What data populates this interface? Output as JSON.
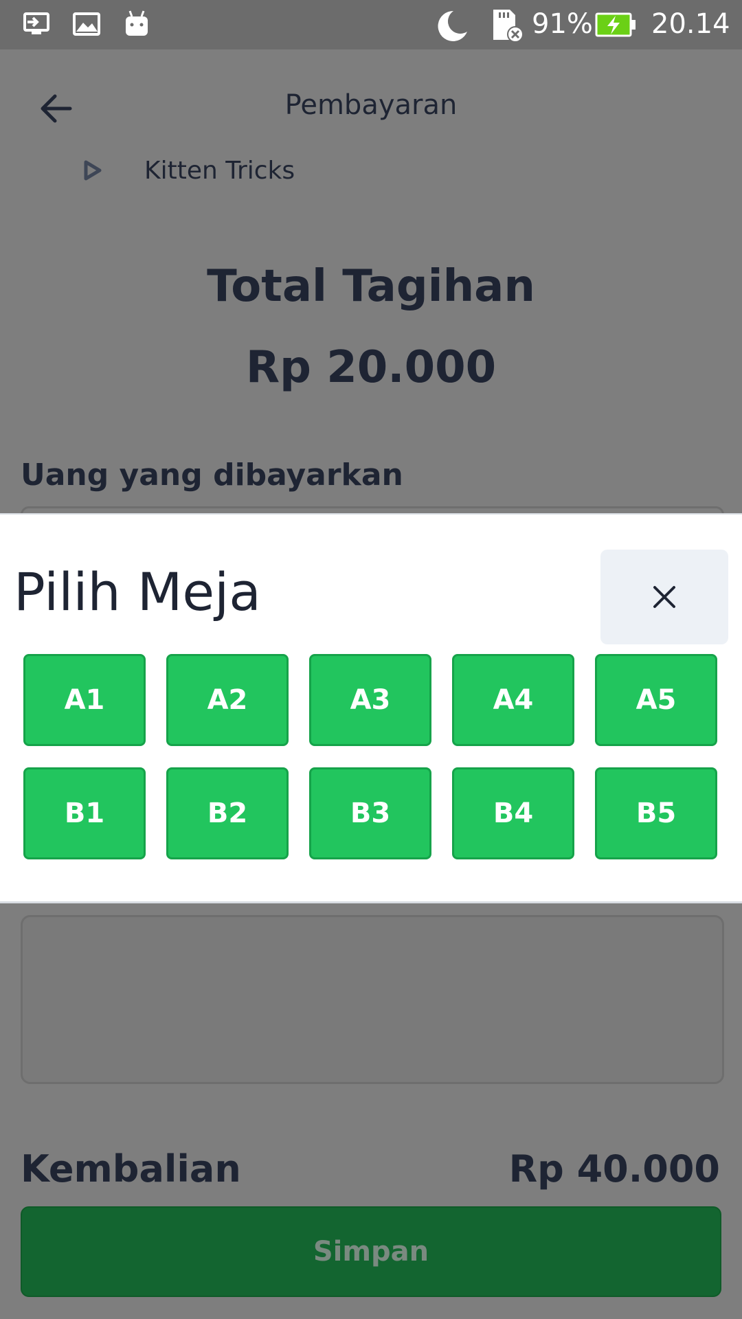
{
  "status_bar": {
    "battery_percent": "91%",
    "time": "20.14",
    "icons": [
      "screen-share-icon",
      "image-icon",
      "android-icon",
      "moon-icon",
      "sdcard-error-icon",
      "battery-charging-icon"
    ]
  },
  "app_bar": {
    "title": "Pembayaran",
    "back_icon": "arrow-left-icon"
  },
  "subnav": {
    "label": "Kitten Tricks",
    "icon": "play-icon"
  },
  "summary": {
    "total_title": "Total Tagihan",
    "total_amount": "Rp 20.000",
    "paid_label": "Uang yang dibayarkan",
    "change_label": "Kembalian",
    "change_amount": "Rp 40.000"
  },
  "save_button": {
    "label": "Simpan"
  },
  "modal": {
    "title": "Pilih Meja",
    "close_icon": "close-icon",
    "tables": [
      "A1",
      "A2",
      "A3",
      "A4",
      "A5",
      "B1",
      "B2",
      "B3",
      "B4",
      "B5"
    ]
  },
  "colors": {
    "table_button": "#22c55e",
    "save_button": "#136530",
    "text_dark": "#1e2433",
    "overlay": "#7e7e7e"
  }
}
